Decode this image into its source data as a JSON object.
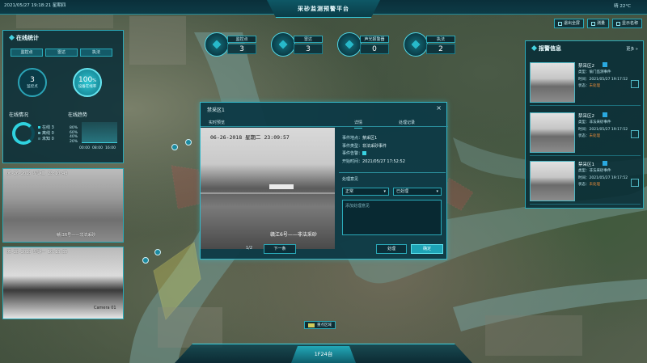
{
  "header": {
    "datetime": "2021/05/27 19:18:21   星期四",
    "title": "采砂监测预警平台",
    "weather": "晴 22°C"
  },
  "toolbar": [
    {
      "label": "退出全屏",
      "icon": "fullscreen-icon"
    },
    {
      "label": "测量",
      "icon": "ruler-icon"
    },
    {
      "label": "显示名称",
      "icon": "label-icon"
    }
  ],
  "stats": [
    {
      "label": "监控点",
      "value": "3"
    },
    {
      "label": "雷达",
      "value": "3"
    },
    {
      "label": "声光报警器",
      "value": "0"
    },
    {
      "label": "执法",
      "value": "2"
    }
  ],
  "left_panel": {
    "title": "在线统计",
    "tabs": [
      "监控点",
      "雷达",
      "执法"
    ],
    "monitor_count": {
      "value": "3",
      "label": "监控点"
    },
    "online_rate": {
      "value": "100",
      "unit": "%",
      "label": "设备在线率"
    },
    "online_status_title": "在线情况",
    "online_trend_title": "在线趋势",
    "legend": [
      "在线",
      "离线",
      "未知"
    ],
    "legend_values": [
      "3",
      "0",
      "0"
    ],
    "trend_pcts": [
      "80%",
      "60%",
      "40%",
      "20%"
    ],
    "trend_ticks": [
      "00:00",
      "08:00",
      "16:00"
    ]
  },
  "left_videos": [
    {
      "timestamp": "06-26-2018  星期二  23:10:43",
      "caption": "赣江6号——非法采砂"
    },
    {
      "timestamp": "05-28-2018  星期一  10:18:35",
      "caption": "Camera 01"
    }
  ],
  "modal": {
    "title": "禁采区1",
    "close": "×",
    "tabs": [
      "实时预览",
      "详情",
      "处理记录"
    ],
    "video_timestamp": "06-26-2018  星期二  23:09:57",
    "video_caption": "赣江6号——非法采砂",
    "info": {
      "location_label": "事件地点：",
      "location": "禁采区1",
      "type_label": "事件类型：",
      "type": "非法采砂事件",
      "alert_label": "事件告警：",
      "time_label": "开始时间：",
      "time": "2021/05/27 17:52:52"
    },
    "handling_title": "处理意见",
    "select_a": "正常",
    "select_b": "已处理",
    "textarea_placeholder": "添加处理意见",
    "page": "1/2",
    "next_button": "下一条",
    "process_button": "处理",
    "confirm_button": "确定"
  },
  "right_panel": {
    "title": "报警信息",
    "more": "更多 »",
    "alarms": [
      {
        "name": "禁采区2",
        "type": "类型：偷门监测事件",
        "time": "时间：2021/05/27 19:17:52",
        "status_label": "状态：",
        "status": "未处理"
      },
      {
        "name": "禁采区2",
        "type": "类型：非法采砂事件",
        "time": "时间：2021/05/27 19:17:52",
        "status_label": "状态：",
        "status": "未处理"
      },
      {
        "name": "禁采区1",
        "type": "类型：非法采砂事件",
        "time": "时间：2021/05/27 19:17:52",
        "status_label": "状态：",
        "status": "未处理"
      }
    ]
  },
  "map_legend": "重点区域",
  "bottom_button": "1F24台",
  "colors": {
    "accent": "#2aa9b8",
    "highlight": "#45d2e0",
    "warn": "#e48a3a",
    "zone": "#d0cc5c",
    "panel": "#0a2d37"
  }
}
